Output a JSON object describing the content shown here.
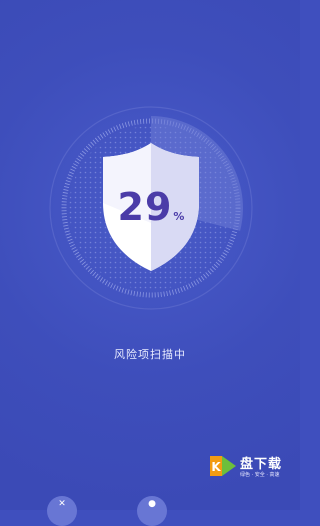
{
  "scan": {
    "percent_value": "29",
    "percent_unit": "%",
    "progress": 0.29,
    "status_text": "风险项扫描中"
  },
  "icons": {
    "shield": "shield-icon",
    "bottom_left": "settings-icon",
    "bottom_right": "chat-icon"
  },
  "watermark": {
    "title": "盘下载",
    "subtitle": "绿色 · 安全 · 高速",
    "logo_char": "K"
  },
  "colors": {
    "background": "#3f4fbe",
    "shield": "#ffffff",
    "shield_shade": "#d8d9f3",
    "percent_text": "#4b3ca8",
    "watermark_orange": "#f39c12",
    "watermark_green": "#6dbf3b"
  }
}
